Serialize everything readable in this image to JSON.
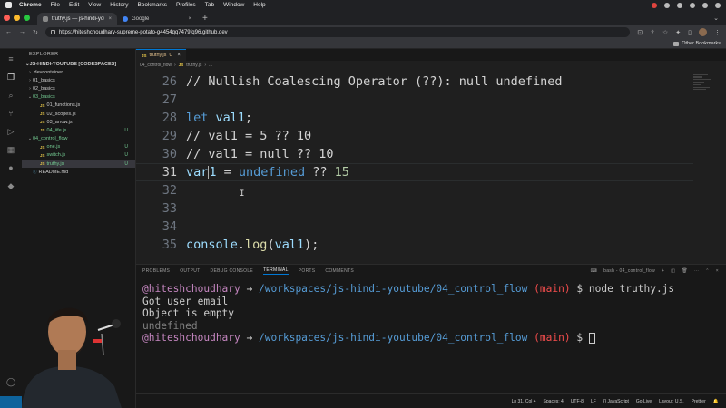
{
  "mac_menu": {
    "app": "Chrome",
    "items": [
      "File",
      "Edit",
      "View",
      "History",
      "Bookmarks",
      "Profiles",
      "Tab",
      "Window",
      "Help"
    ]
  },
  "browser": {
    "tabs": [
      {
        "label": "truthy.js — js-hindi-youtube [C",
        "active": true
      },
      {
        "label": "Google",
        "active": false
      }
    ],
    "url": "https://hiteshchoudhary-supreme-potato-g4454qq7479fq96.github.dev",
    "bookmarks_label": "Other Bookmarks"
  },
  "explorer": {
    "title": "EXPLORER",
    "workspace": "JS-HINDI-YOUTUBE [CODESPACES]",
    "items": [
      {
        "name": ".devcontainer",
        "type": "folder",
        "open": false,
        "level": 1,
        "badge": ""
      },
      {
        "name": "01_basics",
        "type": "folder",
        "open": false,
        "level": 1,
        "badge": ""
      },
      {
        "name": "02_basics",
        "type": "folder",
        "open": false,
        "level": 1,
        "badge": ""
      },
      {
        "name": "03_basics",
        "type": "folder",
        "open": true,
        "level": 1,
        "badge": "",
        "status": "green"
      },
      {
        "name": "01_functions.js",
        "type": "js",
        "level": 2,
        "badge": ""
      },
      {
        "name": "02_scopes.js",
        "type": "js",
        "level": 2,
        "badge": ""
      },
      {
        "name": "03_arrow.js",
        "type": "js",
        "level": 2,
        "badge": ""
      },
      {
        "name": "04_iife.js",
        "type": "js",
        "level": 2,
        "badge": "U",
        "status": "green"
      },
      {
        "name": "04_control_flow",
        "type": "folder",
        "open": true,
        "level": 1,
        "badge": "",
        "status": "green"
      },
      {
        "name": "one.js",
        "type": "js",
        "level": 2,
        "badge": "U",
        "status": "green"
      },
      {
        "name": "switch.js",
        "type": "js",
        "level": 2,
        "badge": "U",
        "status": "green"
      },
      {
        "name": "truthy.js",
        "type": "js",
        "level": 2,
        "badge": "U",
        "status": "green",
        "selected": true
      },
      {
        "name": "README.md",
        "type": "md",
        "level": 1,
        "badge": ""
      }
    ]
  },
  "editor": {
    "tab_label": "truthy.js",
    "tab_badge": "U",
    "breadcrumb": [
      "04_control_flow",
      "truthy.js",
      "..."
    ],
    "lines": [
      {
        "no": "26",
        "tokens": [
          {
            "t": "// Nullish Coalescing Operator (??): null undefined",
            "c": "cm"
          }
        ]
      },
      {
        "no": "27",
        "tokens": []
      },
      {
        "no": "28",
        "tokens": [
          {
            "t": "let ",
            "c": "kw"
          },
          {
            "t": "val1",
            "c": "var"
          },
          {
            "t": ";",
            "c": "cm"
          }
        ]
      },
      {
        "no": "29",
        "tokens": [
          {
            "t": "// val1 = 5 ?? 10",
            "c": "cm"
          }
        ]
      },
      {
        "no": "30",
        "tokens": [
          {
            "t": "// val1 = null ?? 10",
            "c": "cm"
          }
        ]
      },
      {
        "no": "31",
        "tokens": [
          {
            "t": "var",
            "c": "var"
          },
          {
            "t": "CARET",
            "c": "caret"
          },
          {
            "t": "1",
            "c": "var"
          },
          {
            "t": " = ",
            "c": "cm"
          },
          {
            "t": "undefined",
            "c": "undef"
          },
          {
            "t": " ?? ",
            "c": "cm"
          },
          {
            "t": "15",
            "c": "num"
          }
        ],
        "current": true
      },
      {
        "no": "32",
        "tokens": []
      },
      {
        "no": "33",
        "tokens": []
      },
      {
        "no": "34",
        "tokens": []
      },
      {
        "no": "35",
        "tokens": [
          {
            "t": "console",
            "c": "var"
          },
          {
            "t": ".",
            "c": "cm"
          },
          {
            "t": "log",
            "c": "fn"
          },
          {
            "t": "(",
            "c": "cm"
          },
          {
            "t": "val1",
            "c": "var"
          },
          {
            "t": ");",
            "c": "cm"
          }
        ]
      }
    ]
  },
  "panel": {
    "tabs": [
      "PROBLEMS",
      "OUTPUT",
      "DEBUG CONSOLE",
      "TERMINAL",
      "PORTS",
      "COMMENTS"
    ],
    "active_tab": "TERMINAL",
    "terminal_name": "bash - 04_control_flow",
    "terminal": {
      "user": "@hiteshchoudhary",
      "arrow": "→",
      "path": "/workspaces/js-hindi-youtube/04_control_flow",
      "branch_open": "(",
      "branch": "main",
      "branch_close": ")",
      "prompt": "$",
      "command": "node truthy.js",
      "output": [
        "Got user email",
        "Object is empty",
        "undefined"
      ]
    }
  },
  "statusbar": {
    "items": [
      "Ln 31, Col 4",
      "Spaces: 4",
      "UTF-8",
      "LF",
      "{} JavaScript",
      "Go Live",
      "Layout: U.S.",
      "Prettier"
    ]
  }
}
